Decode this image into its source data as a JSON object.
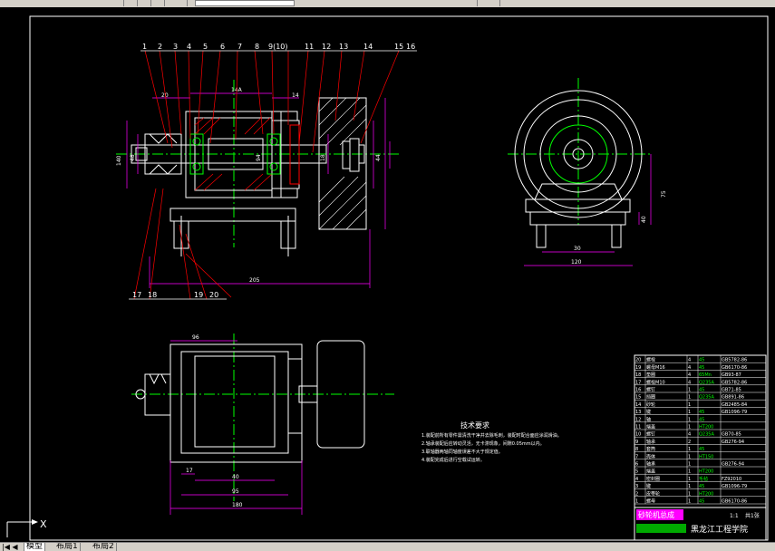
{
  "tabs": {
    "nav": "|◀ ◀ ▶ ▶|",
    "model": "模型",
    "layout1": "布局1",
    "layout2": "布局2"
  },
  "drawing": {
    "balloons": [
      "1",
      "2",
      "3",
      "4",
      "5",
      "6",
      "7",
      "8",
      "9(10)",
      "11",
      "12",
      "13",
      "14",
      "15",
      "16"
    ],
    "balloons_bottom": [
      "17",
      "18",
      "19",
      "20"
    ],
    "dims_main": {
      "d20": "20",
      "d14a": "14A",
      "d14": "14",
      "d94": "94",
      "d18": "18",
      "d44": "44",
      "d205": "205",
      "d48": "48",
      "d140": "140"
    },
    "dims_side": {
      "d75": "75",
      "d30": "30",
      "d120": "120",
      "d40": "40"
    },
    "dims_bottom": {
      "d96": "96",
      "d17": "17",
      "d40": "40",
      "d95": "95",
      "d180": "180",
      "d190": "190"
    },
    "tech_title": "技术要求",
    "tech_lines": [
      "1.装配前所有零件需清洗干净并去除毛刺，装配时配合面应涂润滑油。",
      "2.轴承装配后应转动灵活，无卡滞现象，间隙0.05mm以内。",
      "3.联轴器两轴同轴度误差不大于规定值。",
      "4.装配完成后进行空载试运转。"
    ],
    "bom_rows": [
      {
        "no": "20",
        "name": "螺栓",
        "qty": "4",
        "mat": "45",
        "std": "GB5782-86"
      },
      {
        "no": "19",
        "name": "螺母M16",
        "qty": "4",
        "mat": "45",
        "std": "GB6170-86"
      },
      {
        "no": "18",
        "name": "垫圈",
        "qty": "4",
        "mat": "65Mn",
        "std": "GB93-87"
      },
      {
        "no": "17",
        "name": "螺栓M10",
        "qty": "4",
        "mat": "Q235A",
        "std": "GB5782-86"
      },
      {
        "no": "16",
        "name": "螺钉",
        "qty": "1",
        "mat": "45",
        "std": "GB71-85"
      },
      {
        "no": "15",
        "name": "挡圈",
        "qty": "1",
        "mat": "Q235A",
        "std": "GB891-86"
      },
      {
        "no": "14",
        "name": "砂轮",
        "qty": "1",
        "mat": "",
        "std": "GB2485-84"
      },
      {
        "no": "13",
        "name": "键",
        "qty": "1",
        "mat": "45",
        "std": "GB1096-79"
      },
      {
        "no": "12",
        "name": "轴",
        "qty": "1",
        "mat": "45",
        "std": ""
      },
      {
        "no": "11",
        "name": "端盖",
        "qty": "1",
        "mat": "HT200",
        "std": ""
      },
      {
        "no": "10",
        "name": "螺钉",
        "qty": "4",
        "mat": "Q235A",
        "std": "GB70-85"
      },
      {
        "no": "9",
        "name": "轴承",
        "qty": "2",
        "mat": "",
        "std": "GB276-94"
      },
      {
        "no": "8",
        "name": "套筒",
        "qty": "1",
        "mat": "45",
        "std": ""
      },
      {
        "no": "7",
        "name": "壳体",
        "qty": "1",
        "mat": "HT150",
        "std": ""
      },
      {
        "no": "6",
        "name": "轴承",
        "qty": "1",
        "mat": "",
        "std": "GB276-94"
      },
      {
        "no": "5",
        "name": "端盖",
        "qty": "1",
        "mat": "HT200",
        "std": ""
      },
      {
        "no": "4",
        "name": "密封圈",
        "qty": "1",
        "mat": "毛毡",
        "std": "FZ92010"
      },
      {
        "no": "3",
        "name": "键",
        "qty": "1",
        "mat": "45",
        "std": "GB1096-79"
      },
      {
        "no": "2",
        "name": "皮带轮",
        "qty": "1",
        "mat": "HT200",
        "std": ""
      },
      {
        "no": "1",
        "name": "螺母",
        "qty": "1",
        "mat": "45",
        "std": "GB6170-86"
      }
    ],
    "title_block": {
      "drawing_name": "砂轮机总成",
      "school": "黑龙江工程学院",
      "scale": "1:1",
      "sheet": "共1张"
    },
    "ucs_label": "X"
  },
  "colors": {
    "bg": "#000000",
    "outline": "#ffffff",
    "centerline": "#00ff00",
    "leader": "#ff0000",
    "dimension": "#ff00ff",
    "hidden": "#ffff00"
  }
}
